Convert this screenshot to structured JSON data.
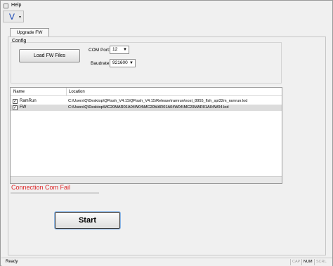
{
  "menubar": {
    "help_label": "Help"
  },
  "toolbar": {
    "icon": "double-chevron-icon"
  },
  "tabs": [
    {
      "label": "Upgrade FW"
    }
  ],
  "config": {
    "group_label": "Config",
    "load_button_label": "Load FW Files",
    "com_port_label": "COM Port:",
    "com_port_value": "12",
    "baudrate_label": "Baudrate:",
    "baudrate_value": "921600"
  },
  "file_list": {
    "columns": [
      "Name",
      "Location"
    ],
    "rows": [
      {
        "checked": true,
        "name": "RamRun",
        "location": "C:\\Users\\Q\\Desktop\\QFlash_V4.11\\QFlash_V4.11\\Release\\ramrun\\nost_8955_flsh_spi32m_ramrun.lod"
      },
      {
        "checked": true,
        "name": "FW",
        "location": "C:\\Users\\Q\\Desktop\\MC20MAR01A04W04\\MC20MAR01A04W04\\MC20MAR01A04W04.lod"
      }
    ]
  },
  "status": {
    "error_text": "Connection Com Fail",
    "progress": 0
  },
  "start_button_label": "Start",
  "statusbar": {
    "ready_text": "Ready",
    "indicators": [
      "CAP",
      "NUM",
      "SCRL"
    ]
  },
  "colors": {
    "error": "#e0292b",
    "selected_row": "#dcdcdc",
    "accent": "#2a55b8"
  }
}
